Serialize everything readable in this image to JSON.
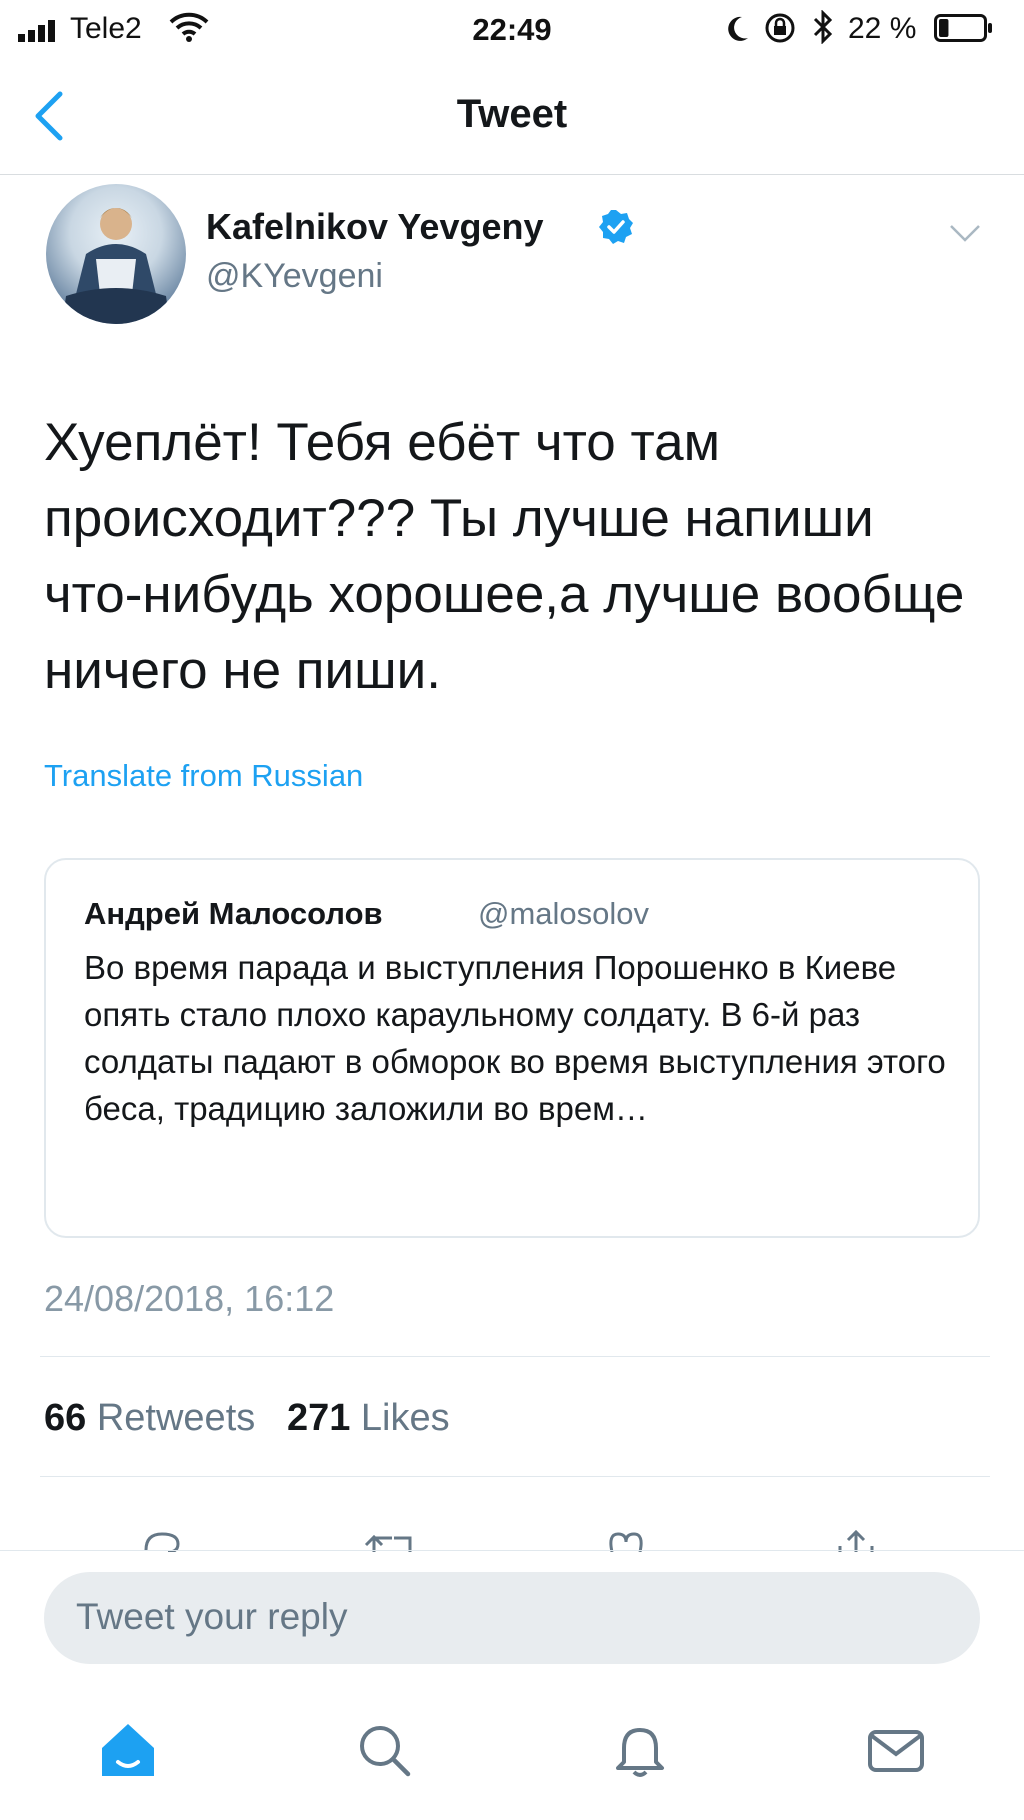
{
  "status_bar": {
    "carrier": "Tele2",
    "time": "22:49",
    "battery": "22 %",
    "battery_level": 0.22
  },
  "nav": {
    "title": "Tweet"
  },
  "tweet": {
    "author_name": "Kafelnikov Yevgeny",
    "author_handle": "@KYevgeni",
    "text": "Хуеплёт! Тебя ебёт что там происходит??? Ты лучше напиши что-нибудь хорошее,а лучше вообще ничего не пиши.",
    "translate_label": "Translate from Russian",
    "timestamp": "24/08/2018, 16:12",
    "retweets_count": "66",
    "retweets_label": "Retweets",
    "likes_count": "271",
    "likes_label": "Likes"
  },
  "quoted": {
    "author_name": "Андрей Малосолов",
    "author_handle": "@malosolov",
    "text": "Во время парада и выступления Порошенко в Киеве опять стало плохо караульному солдату. В 6-й раз солдаты падают в обморок во время выступления этого беса, традицию заложили во врем…"
  },
  "reply": {
    "placeholder": "Tweet your reply"
  },
  "colors": {
    "accent": "#1da1f2",
    "secondary_text": "#657786"
  }
}
